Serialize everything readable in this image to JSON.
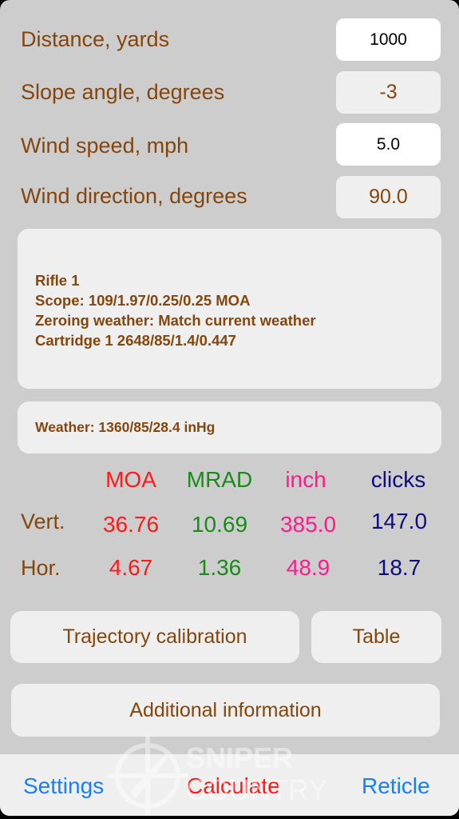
{
  "inputs": [
    {
      "label": "Distance, yards",
      "value": "1000",
      "editable": true
    },
    {
      "label": "Slope angle, degrees",
      "value": "-3",
      "editable": false
    },
    {
      "label": "Wind speed, mph",
      "value": "5.0",
      "editable": true
    },
    {
      "label": "Wind direction, degrees",
      "value": "90.0",
      "editable": false
    }
  ],
  "profile": {
    "rifle": "Rifle 1",
    "scope": "Scope: 109/1.97/0.25/0.25 MOA",
    "zeroing": "Zeroing weather: Match current weather",
    "cartridge": "Cartridge 1 2648/85/1.4/0.447"
  },
  "weather": "Weather: 1360/85/28.4 inHg",
  "results": {
    "headers": [
      "MOA",
      "MRAD",
      "inch",
      "clicks"
    ],
    "colors": [
      "#ff1a1a",
      "#1a8a1a",
      "#ff1a8c",
      "#0d0d80"
    ],
    "rows": [
      {
        "label": "Vert.",
        "values": [
          "36.76",
          "10.69",
          "385.0",
          "147.0"
        ]
      },
      {
        "label": "Hor.",
        "values": [
          "4.67",
          "1.36",
          "48.9",
          "18.7"
        ]
      }
    ]
  },
  "buttons": {
    "calibration": "Trajectory calibration",
    "table": "Table",
    "additional": "Additional information"
  },
  "tabbar": {
    "settings": "Settings",
    "calculate": "Calculate",
    "reticle": "Reticle"
  },
  "watermark": {
    "line1": "SNIPER",
    "line2": "COUNTRY"
  }
}
